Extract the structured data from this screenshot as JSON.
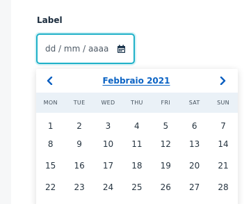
{
  "field": {
    "label": "Label",
    "placeholder": "dd / mm / aaaa",
    "icon": "calendar-icon"
  },
  "calendar": {
    "month_title": "Febbraio 2021",
    "prev_icon": "chevron-left-icon",
    "next_icon": "chevron-right-icon",
    "weekdays": [
      "MON",
      "TUE",
      "WED",
      "THU",
      "FRI",
      "SAT",
      "SUN"
    ],
    "weeks": [
      [
        "1",
        "2",
        "3",
        "4",
        "5",
        "6",
        "7"
      ],
      [
        "8",
        "9",
        "10",
        "11",
        "12",
        "13",
        "14"
      ],
      [
        "15",
        "16",
        "17",
        "18",
        "19",
        "20",
        "21"
      ],
      [
        "22",
        "23",
        "24",
        "25",
        "26",
        "27",
        "28"
      ]
    ]
  },
  "colors": {
    "accent_border": "#1fb1c8",
    "link_blue": "#0b63c4",
    "header_bg": "#eaf1f7"
  }
}
